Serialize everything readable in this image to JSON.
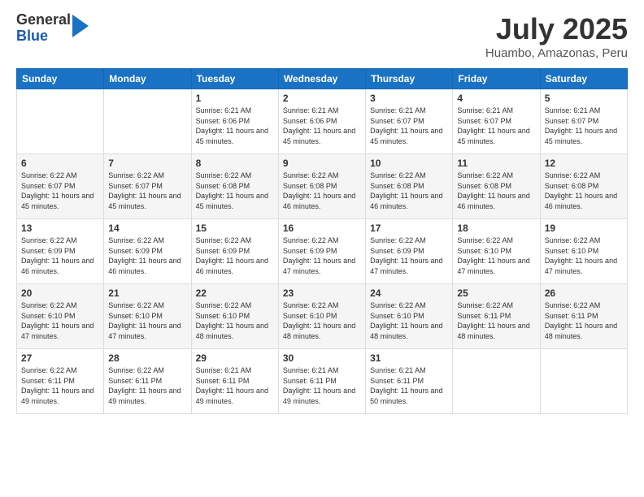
{
  "logo": {
    "general": "General",
    "blue": "Blue"
  },
  "header": {
    "month_year": "July 2025",
    "location": "Huambo, Amazonas, Peru"
  },
  "days_of_week": [
    "Sunday",
    "Monday",
    "Tuesday",
    "Wednesday",
    "Thursday",
    "Friday",
    "Saturday"
  ],
  "weeks": [
    [
      {
        "day": "",
        "sunrise": "",
        "sunset": "",
        "daylight": ""
      },
      {
        "day": "",
        "sunrise": "",
        "sunset": "",
        "daylight": ""
      },
      {
        "day": "1",
        "sunrise": "Sunrise: 6:21 AM",
        "sunset": "Sunset: 6:06 PM",
        "daylight": "Daylight: 11 hours and 45 minutes."
      },
      {
        "day": "2",
        "sunrise": "Sunrise: 6:21 AM",
        "sunset": "Sunset: 6:06 PM",
        "daylight": "Daylight: 11 hours and 45 minutes."
      },
      {
        "day": "3",
        "sunrise": "Sunrise: 6:21 AM",
        "sunset": "Sunset: 6:07 PM",
        "daylight": "Daylight: 11 hours and 45 minutes."
      },
      {
        "day": "4",
        "sunrise": "Sunrise: 6:21 AM",
        "sunset": "Sunset: 6:07 PM",
        "daylight": "Daylight: 11 hours and 45 minutes."
      },
      {
        "day": "5",
        "sunrise": "Sunrise: 6:21 AM",
        "sunset": "Sunset: 6:07 PM",
        "daylight": "Daylight: 11 hours and 45 minutes."
      }
    ],
    [
      {
        "day": "6",
        "sunrise": "Sunrise: 6:22 AM",
        "sunset": "Sunset: 6:07 PM",
        "daylight": "Daylight: 11 hours and 45 minutes."
      },
      {
        "day": "7",
        "sunrise": "Sunrise: 6:22 AM",
        "sunset": "Sunset: 6:07 PM",
        "daylight": "Daylight: 11 hours and 45 minutes."
      },
      {
        "day": "8",
        "sunrise": "Sunrise: 6:22 AM",
        "sunset": "Sunset: 6:08 PM",
        "daylight": "Daylight: 11 hours and 45 minutes."
      },
      {
        "day": "9",
        "sunrise": "Sunrise: 6:22 AM",
        "sunset": "Sunset: 6:08 PM",
        "daylight": "Daylight: 11 hours and 46 minutes."
      },
      {
        "day": "10",
        "sunrise": "Sunrise: 6:22 AM",
        "sunset": "Sunset: 6:08 PM",
        "daylight": "Daylight: 11 hours and 46 minutes."
      },
      {
        "day": "11",
        "sunrise": "Sunrise: 6:22 AM",
        "sunset": "Sunset: 6:08 PM",
        "daylight": "Daylight: 11 hours and 46 minutes."
      },
      {
        "day": "12",
        "sunrise": "Sunrise: 6:22 AM",
        "sunset": "Sunset: 6:08 PM",
        "daylight": "Daylight: 11 hours and 46 minutes."
      }
    ],
    [
      {
        "day": "13",
        "sunrise": "Sunrise: 6:22 AM",
        "sunset": "Sunset: 6:09 PM",
        "daylight": "Daylight: 11 hours and 46 minutes."
      },
      {
        "day": "14",
        "sunrise": "Sunrise: 6:22 AM",
        "sunset": "Sunset: 6:09 PM",
        "daylight": "Daylight: 11 hours and 46 minutes."
      },
      {
        "day": "15",
        "sunrise": "Sunrise: 6:22 AM",
        "sunset": "Sunset: 6:09 PM",
        "daylight": "Daylight: 11 hours and 46 minutes."
      },
      {
        "day": "16",
        "sunrise": "Sunrise: 6:22 AM",
        "sunset": "Sunset: 6:09 PM",
        "daylight": "Daylight: 11 hours and 47 minutes."
      },
      {
        "day": "17",
        "sunrise": "Sunrise: 6:22 AM",
        "sunset": "Sunset: 6:09 PM",
        "daylight": "Daylight: 11 hours and 47 minutes."
      },
      {
        "day": "18",
        "sunrise": "Sunrise: 6:22 AM",
        "sunset": "Sunset: 6:10 PM",
        "daylight": "Daylight: 11 hours and 47 minutes."
      },
      {
        "day": "19",
        "sunrise": "Sunrise: 6:22 AM",
        "sunset": "Sunset: 6:10 PM",
        "daylight": "Daylight: 11 hours and 47 minutes."
      }
    ],
    [
      {
        "day": "20",
        "sunrise": "Sunrise: 6:22 AM",
        "sunset": "Sunset: 6:10 PM",
        "daylight": "Daylight: 11 hours and 47 minutes."
      },
      {
        "day": "21",
        "sunrise": "Sunrise: 6:22 AM",
        "sunset": "Sunset: 6:10 PM",
        "daylight": "Daylight: 11 hours and 47 minutes."
      },
      {
        "day": "22",
        "sunrise": "Sunrise: 6:22 AM",
        "sunset": "Sunset: 6:10 PM",
        "daylight": "Daylight: 11 hours and 48 minutes."
      },
      {
        "day": "23",
        "sunrise": "Sunrise: 6:22 AM",
        "sunset": "Sunset: 6:10 PM",
        "daylight": "Daylight: 11 hours and 48 minutes."
      },
      {
        "day": "24",
        "sunrise": "Sunrise: 6:22 AM",
        "sunset": "Sunset: 6:10 PM",
        "daylight": "Daylight: 11 hours and 48 minutes."
      },
      {
        "day": "25",
        "sunrise": "Sunrise: 6:22 AM",
        "sunset": "Sunset: 6:11 PM",
        "daylight": "Daylight: 11 hours and 48 minutes."
      },
      {
        "day": "26",
        "sunrise": "Sunrise: 6:22 AM",
        "sunset": "Sunset: 6:11 PM",
        "daylight": "Daylight: 11 hours and 48 minutes."
      }
    ],
    [
      {
        "day": "27",
        "sunrise": "Sunrise: 6:22 AM",
        "sunset": "Sunset: 6:11 PM",
        "daylight": "Daylight: 11 hours and 49 minutes."
      },
      {
        "day": "28",
        "sunrise": "Sunrise: 6:22 AM",
        "sunset": "Sunset: 6:11 PM",
        "daylight": "Daylight: 11 hours and 49 minutes."
      },
      {
        "day": "29",
        "sunrise": "Sunrise: 6:21 AM",
        "sunset": "Sunset: 6:11 PM",
        "daylight": "Daylight: 11 hours and 49 minutes."
      },
      {
        "day": "30",
        "sunrise": "Sunrise: 6:21 AM",
        "sunset": "Sunset: 6:11 PM",
        "daylight": "Daylight: 11 hours and 49 minutes."
      },
      {
        "day": "31",
        "sunrise": "Sunrise: 6:21 AM",
        "sunset": "Sunset: 6:11 PM",
        "daylight": "Daylight: 11 hours and 50 minutes."
      },
      {
        "day": "",
        "sunrise": "",
        "sunset": "",
        "daylight": ""
      },
      {
        "day": "",
        "sunrise": "",
        "sunset": "",
        "daylight": ""
      }
    ]
  ]
}
